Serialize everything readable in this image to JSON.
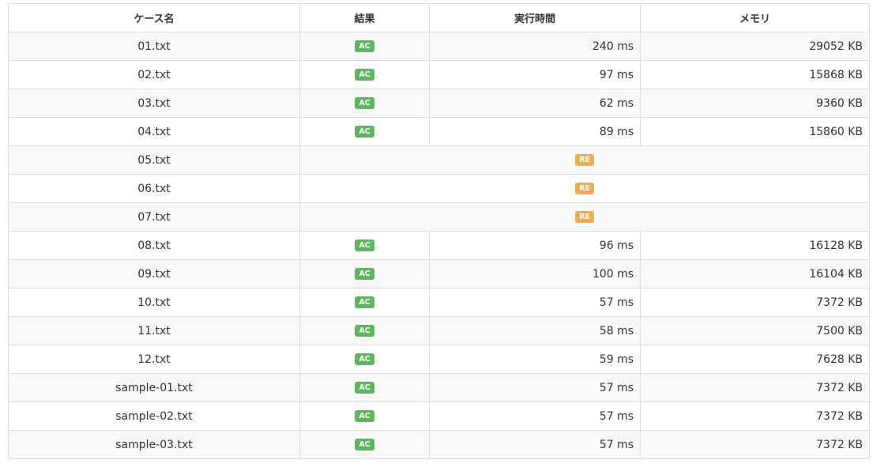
{
  "headers": {
    "case_name": "ケース名",
    "result": "結果",
    "exec_time": "実行時間",
    "memory": "メモリ"
  },
  "colors": {
    "ac_badge": "#5cb85c",
    "re_badge": "#f0ad4e",
    "stripe": "#f9f9f9",
    "border": "#dddddd"
  },
  "rows": [
    {
      "name": "01.txt",
      "status": "AC",
      "time": "240 ms",
      "memory": "29052 KB"
    },
    {
      "name": "02.txt",
      "status": "AC",
      "time": "97 ms",
      "memory": "15868 KB"
    },
    {
      "name": "03.txt",
      "status": "AC",
      "time": "62 ms",
      "memory": "9360 KB"
    },
    {
      "name": "04.txt",
      "status": "AC",
      "time": "89 ms",
      "memory": "15860 KB"
    },
    {
      "name": "05.txt",
      "status": "RE"
    },
    {
      "name": "06.txt",
      "status": "RE"
    },
    {
      "name": "07.txt",
      "status": "RE"
    },
    {
      "name": "08.txt",
      "status": "AC",
      "time": "96 ms",
      "memory": "16128 KB"
    },
    {
      "name": "09.txt",
      "status": "AC",
      "time": "100 ms",
      "memory": "16104 KB"
    },
    {
      "name": "10.txt",
      "status": "AC",
      "time": "57 ms",
      "memory": "7372 KB"
    },
    {
      "name": "11.txt",
      "status": "AC",
      "time": "58 ms",
      "memory": "7500 KB"
    },
    {
      "name": "12.txt",
      "status": "AC",
      "time": "59 ms",
      "memory": "7628 KB"
    },
    {
      "name": "sample-01.txt",
      "status": "AC",
      "time": "57 ms",
      "memory": "7372 KB"
    },
    {
      "name": "sample-02.txt",
      "status": "AC",
      "time": "57 ms",
      "memory": "7372 KB"
    },
    {
      "name": "sample-03.txt",
      "status": "AC",
      "time": "57 ms",
      "memory": "7372 KB"
    }
  ]
}
